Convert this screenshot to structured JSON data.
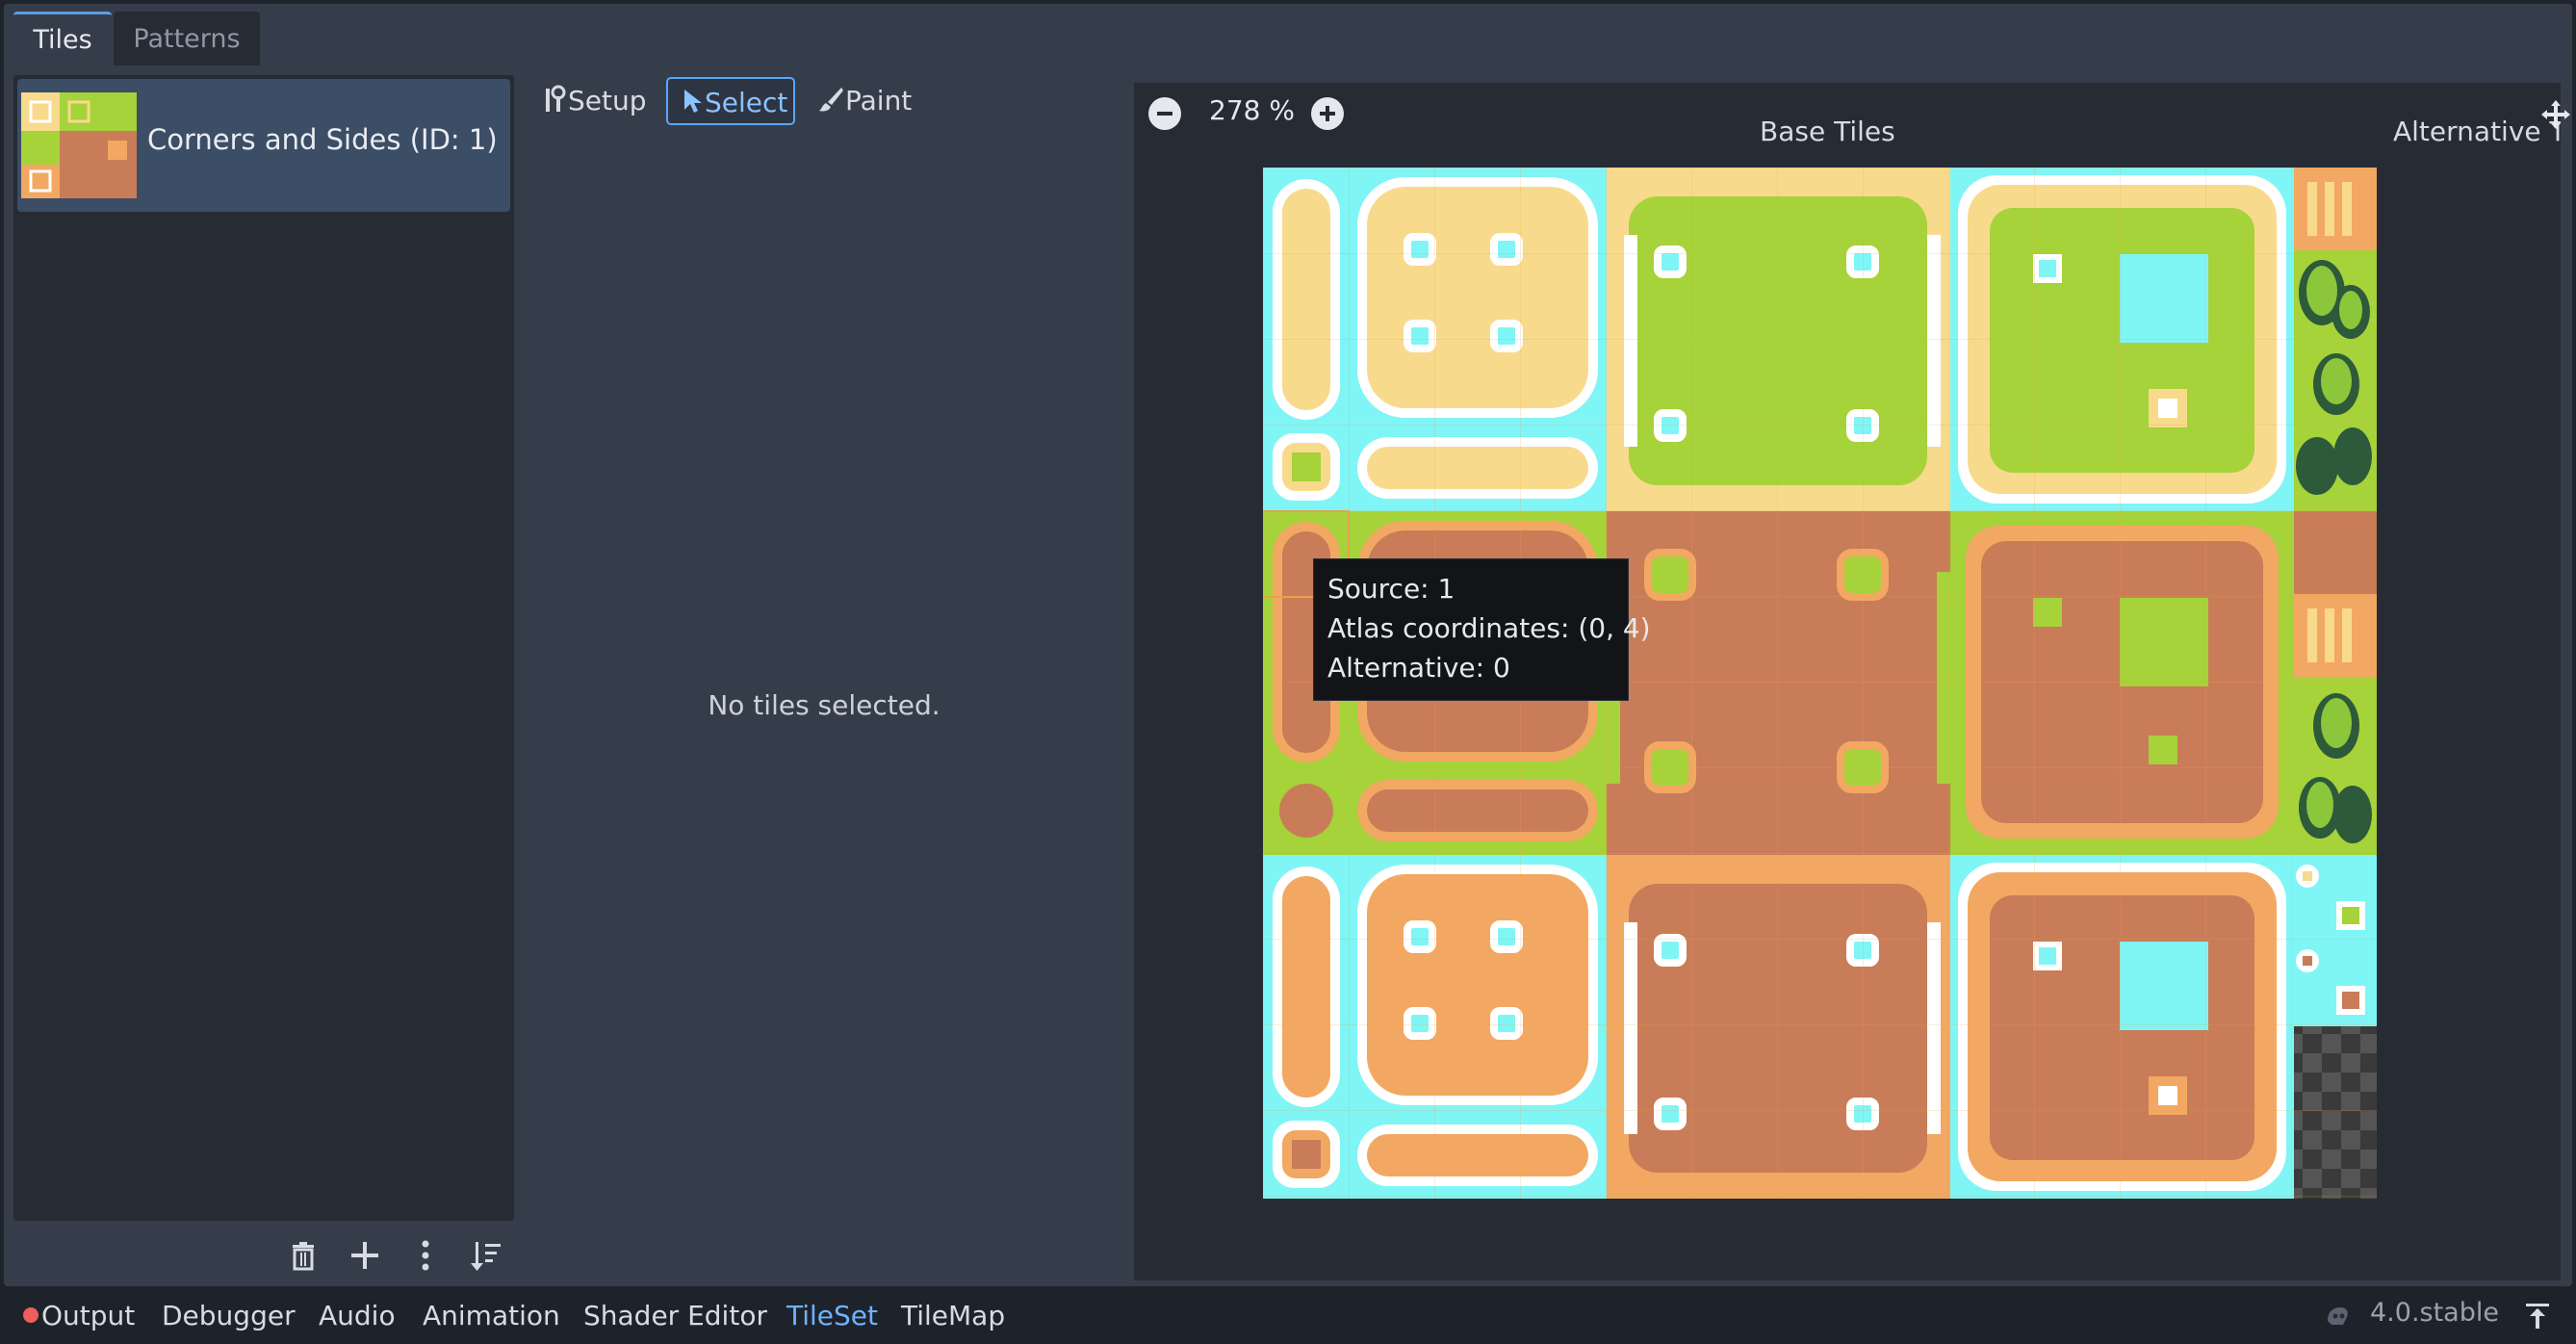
{
  "tabs": [
    {
      "label": "Tiles",
      "active": true
    },
    {
      "label": "Patterns",
      "active": false
    }
  ],
  "source_list": {
    "items": [
      {
        "label": "Corners and Sides (ID: 1)",
        "selected": true
      }
    ],
    "tools": [
      "trash-icon",
      "add-icon",
      "more-vertical-icon",
      "sort-icon"
    ]
  },
  "modes": [
    {
      "label": "Setup",
      "icon": "wrench-icon"
    },
    {
      "label": "Select",
      "icon": "cursor-icon",
      "active": true
    },
    {
      "label": "Paint",
      "icon": "brush-icon"
    }
  ],
  "selection": {
    "empty_text": "No tiles selected."
  },
  "atlas": {
    "zoom": "278 %",
    "base_tiles_label": "Base Tiles",
    "alternative_tiles_label": "Alternative Tiles"
  },
  "tooltip": {
    "source": "Source: 1",
    "atlas_coordinates": "Atlas coordinates: (0, 4)",
    "alternative": "Alternative: 0"
  },
  "bottom_bar": {
    "tabs": [
      "Output",
      "Debugger",
      "Audio",
      "Animation",
      "Shader Editor",
      "TileSet",
      "TileMap"
    ],
    "active_tab": "TileSet",
    "version": "4.0.stable"
  },
  "colors": {
    "panel": "#363d4a",
    "accent": "#5aa6ff",
    "water": "#80f5f5",
    "sand": "#f8da8c",
    "grass": "#a6d23a",
    "dirt": "#c97c58",
    "clay": "#f2a862",
    "tree": "#2d5a3a"
  }
}
